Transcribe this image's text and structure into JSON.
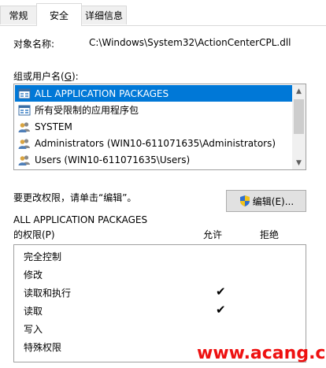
{
  "tabs": {
    "general": "常规",
    "security": "安全",
    "details": "详细信息"
  },
  "object": {
    "label": "对象名称:",
    "value": "C:\\Windows\\System32\\ActionCenterCPL.dll"
  },
  "groups": {
    "label_prefix": "组或用户名(",
    "label_key": "G",
    "label_suffix": "):",
    "items": [
      {
        "label": "ALL APPLICATION PACKAGES",
        "icon": "app-packages-icon",
        "selected": true
      },
      {
        "label": "所有受限制的应用程序包",
        "icon": "app-packages-icon",
        "selected": false
      },
      {
        "label": "SYSTEM",
        "icon": "users-icon",
        "selected": false
      },
      {
        "label": "Administrators (WIN10-611071635\\Administrators)",
        "icon": "users-icon",
        "selected": false
      },
      {
        "label": "Users (WIN10-611071635\\Users)",
        "icon": "users-icon",
        "selected": false
      }
    ]
  },
  "edit": {
    "prompt": "要更改权限，请单击“编辑”。",
    "button_label": "编辑(E)..."
  },
  "permissions": {
    "for_label": "ALL APPLICATION PACKAGES",
    "of_label": "的权限(P)",
    "allow_header": "允许",
    "deny_header": "拒绝",
    "rows": [
      {
        "name": "完全控制",
        "allow": false
      },
      {
        "name": "修改",
        "allow": false
      },
      {
        "name": "读取和执行",
        "allow": true
      },
      {
        "name": "读取",
        "allow": true
      },
      {
        "name": "写入",
        "allow": false
      },
      {
        "name": "特殊权限",
        "allow": false
      }
    ],
    "check_glyph": "✔"
  },
  "watermark": "www.acang.cn",
  "colors": {
    "selection": "#0078d7",
    "watermark": "#ee1111"
  }
}
